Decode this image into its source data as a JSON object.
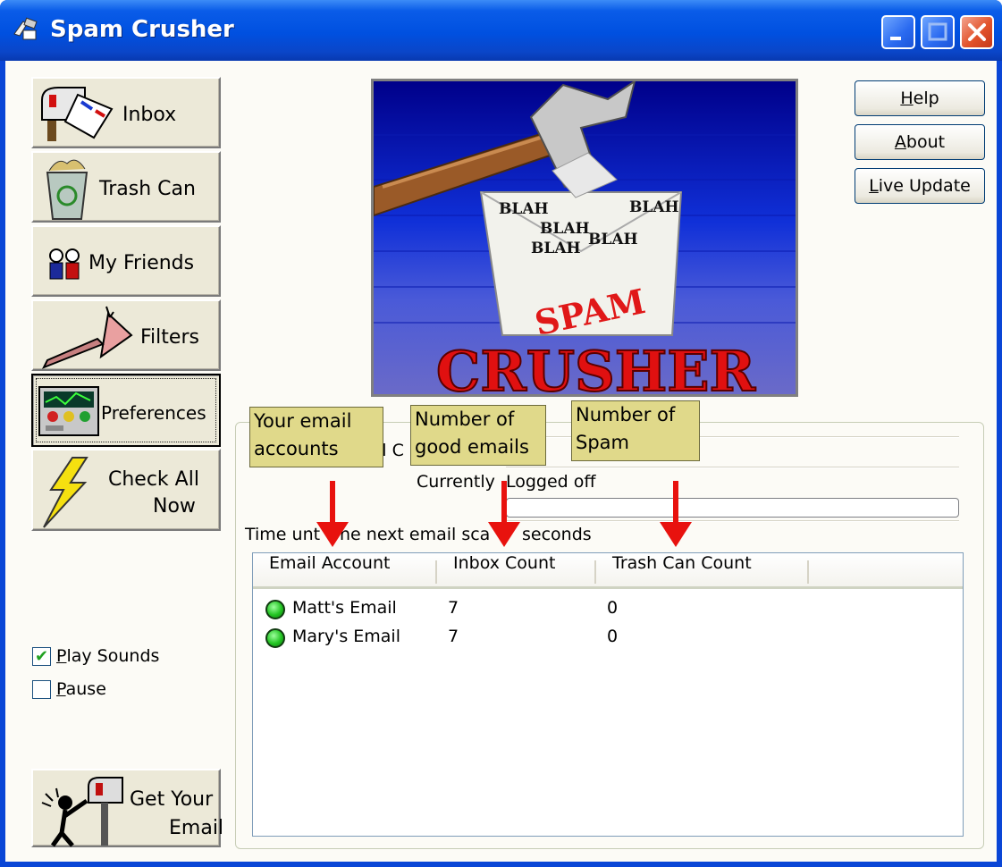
{
  "window": {
    "title": "Spam Crusher"
  },
  "nav": {
    "inbox": "Inbox",
    "trash": "Trash Can",
    "friends": "My Friends",
    "filters": "Filters",
    "preferences": "Preferences",
    "check_all_line1": "Check All",
    "check_all_line2": "Now",
    "get_email_line1": "Get Your",
    "get_email_line2": "Email"
  },
  "options": {
    "play_sounds": {
      "label_first": "P",
      "label_rest": "lay Sounds",
      "checked": true
    },
    "pause": {
      "label_first": "P",
      "label_rest": "ause",
      "checked": false
    }
  },
  "buttons": {
    "help": {
      "first": "H",
      "rest": "elp"
    },
    "about": {
      "first": "A",
      "rest": "bout"
    },
    "live_update": {
      "first": "L",
      "rest": "ive Update"
    }
  },
  "banner": {
    "word_spam": "SPAM",
    "word_crusher": "CRUSHER",
    "blah": "BLAH"
  },
  "status": {
    "email_checking_partial": "il C",
    "currently_label": "Currently",
    "currently_value": "Logged off",
    "time_label_start": "Time unt",
    "time_label_mid": "he next email sca",
    "time_label_end": "seconds"
  },
  "list": {
    "columns": [
      "Email Account",
      "Inbox Count",
      "Trash Can Count"
    ],
    "rows": [
      {
        "account": "Matt's Email",
        "inbox": "7",
        "trash": "0"
      },
      {
        "account": "Mary's Email",
        "inbox": "7",
        "trash": "0"
      }
    ]
  },
  "callouts": {
    "accounts": [
      "Your email",
      "accounts"
    ],
    "good": [
      "Number of",
      "good emails"
    ],
    "spam": [
      "Number of",
      "Spam"
    ]
  },
  "colors": {
    "titlebar": "#0a46d6",
    "callout": "#e0d98a",
    "arrow": "#e8120e",
    "status_green": "#22c422"
  }
}
